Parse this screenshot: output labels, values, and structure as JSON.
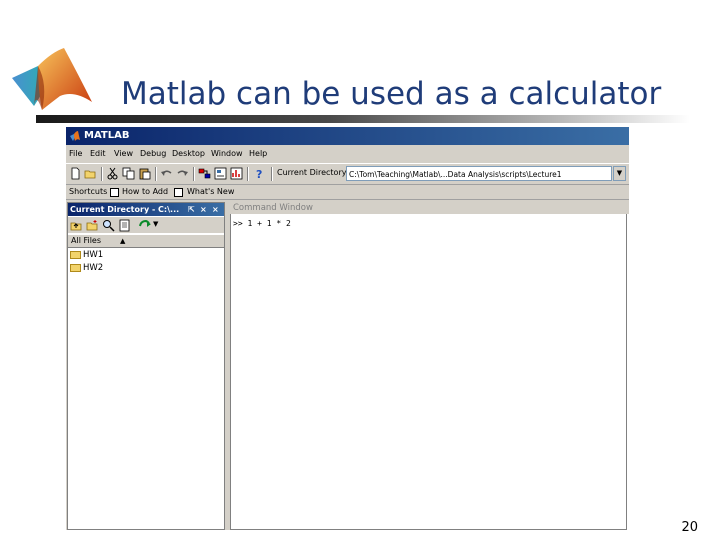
{
  "slide": {
    "title": "Matlab can be used as a calculator",
    "page_number": "20"
  },
  "colors": {
    "title_text": "#1f3c79",
    "title_bar": "#0a246a",
    "window_bg": "#d4d0c8"
  },
  "matlab": {
    "window_title": "MATLAB",
    "menu": [
      "File",
      "Edit",
      "View",
      "Debug",
      "Desktop",
      "Window",
      "Help"
    ],
    "current_directory_label": "Current Directory:",
    "current_directory_value": "C:\\Tom\\Teaching\\Matlab\\...Data Analysis\\scripts\\Lecture1",
    "shortcuts": {
      "label": "Shortcuts",
      "how_to_add": "How to Add",
      "whats_new": "What's New"
    },
    "current_directory_pane": {
      "title": "Current Directory - C:\\...",
      "column_header": "All Files",
      "files": [
        "HW1",
        "HW2"
      ]
    },
    "command_window": {
      "title": "Command Window",
      "line": ">> 1 + 1 * 2"
    },
    "icons": [
      "matlab-logo-icon",
      "new-file-icon",
      "open-icon",
      "cut-icon",
      "copy-icon",
      "paste-icon",
      "undo-icon",
      "redo-icon",
      "simulink-icon",
      "guide-icon",
      "profiler-icon",
      "help-icon",
      "folder-icon"
    ]
  }
}
